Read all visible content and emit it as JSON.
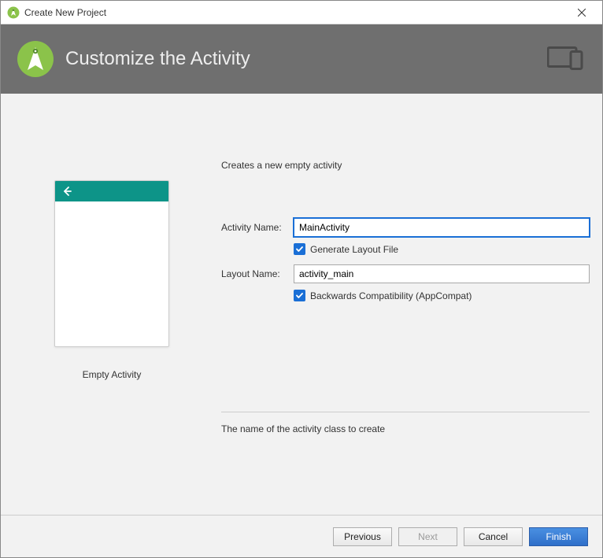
{
  "window": {
    "title": "Create New Project"
  },
  "banner": {
    "heading": "Customize the Activity"
  },
  "preview": {
    "template_name": "Empty Activity"
  },
  "form": {
    "intro": "Creates a new empty activity",
    "activity_name_label": "Activity Name:",
    "activity_name_value": "MainActivity",
    "generate_layout_label": "Generate Layout File",
    "generate_layout_checked": true,
    "layout_name_label": "Layout Name:",
    "layout_name_value": "activity_main",
    "backcompat_label": "Backwards Compatibility (AppCompat)",
    "backcompat_checked": true,
    "help_text": "The name of the activity class to create"
  },
  "footer": {
    "previous": "Previous",
    "next": "Next",
    "cancel": "Cancel",
    "finish": "Finish"
  }
}
